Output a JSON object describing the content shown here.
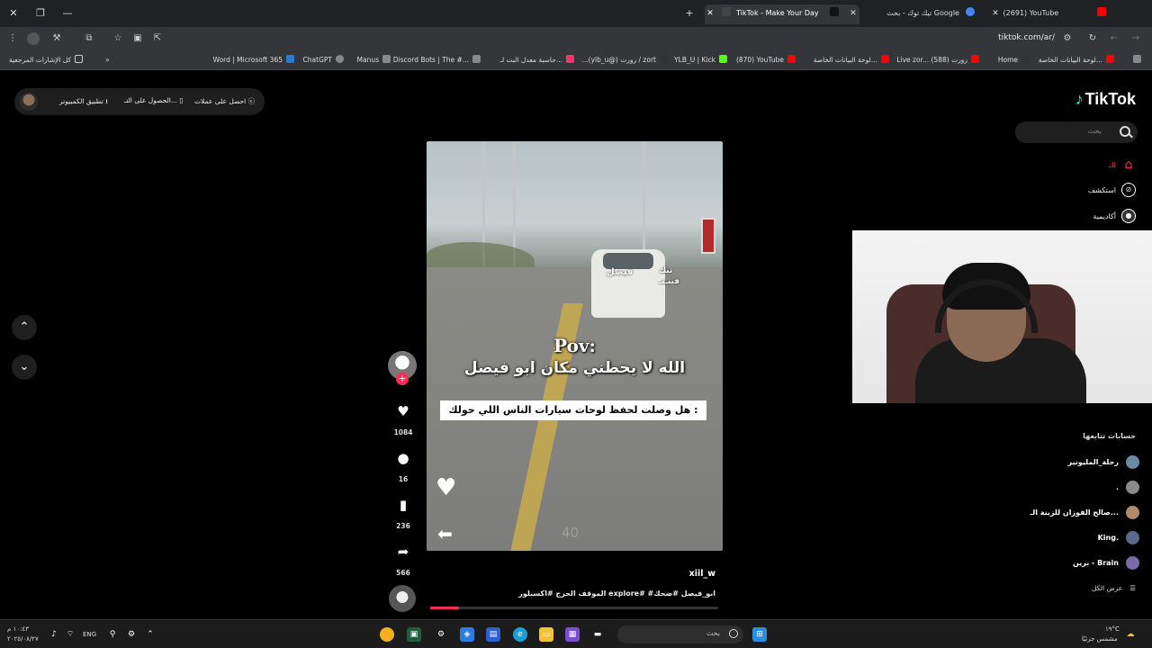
{
  "browser": {
    "tabs": [
      {
        "title": "(2691) YouTube",
        "color": "#ff0000"
      },
      {
        "title": "تيك توك - بحث Google",
        "color": "#4285f4"
      },
      {
        "title": "TikTok - Make Your Day",
        "color": "#ffffff"
      }
    ],
    "url": "tiktok.com/ar/",
    "bookmarks": [
      {
        "label": "لوحة البيانات الخاصة...",
        "color": "#ff0000"
      },
      {
        "label": "Home",
        "color": "#333333"
      },
      {
        "label": "Live zor... (588) زورت",
        "color": "#ff0000"
      },
      {
        "label": "لوحة البيانات الخاصة...",
        "color": "#ff0000"
      },
      {
        "label": "(870) YouTube",
        "color": "#ff0000"
      },
      {
        "label": "YLB_U | Kick",
        "color": "#53fc18"
      },
      {
        "label": "...(ylb_u@) زورت / zort",
        "color": "#333333"
      },
      {
        "label": "حاسبة معدل البت لـ...",
        "color": "#ff3366"
      },
      {
        "label": "Discord Bots | The #...",
        "color": "#888888"
      },
      {
        "label": "Manus",
        "color": "#888888"
      },
      {
        "label": "ChatGPT",
        "color": "#888888"
      },
      {
        "label": "Word | Microsoft 365",
        "color": "#2b7cd3"
      },
      {
        "label": "كل الإشارات المرجعية",
        "color": "#888888"
      }
    ]
  },
  "tiktok": {
    "logo": "TikTok",
    "search_placeholder": "بحث",
    "top_actions": {
      "coins": "احصل على عملات",
      "get_app": "الحصول على التـ...",
      "desktop_app": "تطبيق الكمبيوتر"
    },
    "nav": {
      "home": "لك",
      "explore": "استكشف",
      "live": "أكاديمية"
    },
    "following_title": "حسابات تتابعها",
    "following": [
      {
        "name": "رحلة_المليونير",
        "color": "#6b8aa6"
      },
      {
        "name": ".",
        "color": "#8a8a8a"
      },
      {
        "name": "صالح الفوزان للزينة الـ...",
        "color": "#b08a6a"
      },
      {
        "name": "King.",
        "color": "#5a6a8a"
      },
      {
        "name": "برين - Brain",
        "color": "#7a6aa8"
      }
    ],
    "see_all": "عرض الكل",
    "video": {
      "pov": "Pov:",
      "line1": "الله لا يحطني مكان ابو فيصل",
      "box": "هل وصلت لحفظ لوحات سيارات الناس اللي حولك :",
      "tag_car": "فيصل",
      "tag_car2a": "تيك",
      "tag_car2b": "فينـتـ",
      "speed": "40"
    },
    "actions": {
      "likes": "1084",
      "comments": "16",
      "saves": "236",
      "shares": "566"
    },
    "author": "xiil_w",
    "caption": "الموقف الحرج #اكسبلور explore# #ابو_فيصل #ضحك",
    "progress": 0.1
  },
  "taskbar": {
    "search_placeholder": "بحث",
    "lang": "ENG",
    "time": "١٠:٤٣ م",
    "date": "٢٠٢٥/٠٨/٢٧",
    "weather_temp": "١٩°C",
    "weather_text": "مشمس جزئيًا"
  }
}
